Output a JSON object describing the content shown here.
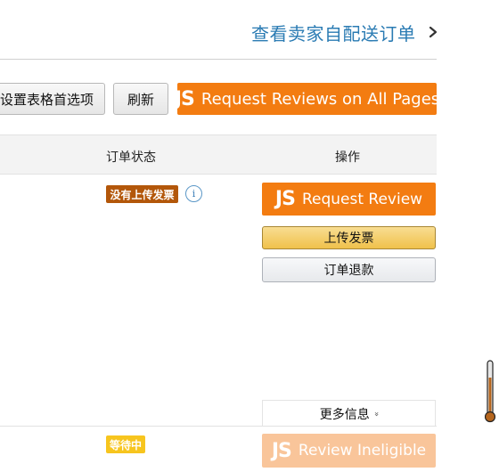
{
  "header": {
    "seller_link": "查看卖家自配送订单"
  },
  "toolbar": {
    "prefs_label": "设置表格首选项",
    "refresh_label": "刷新",
    "request_all_logo": "JS",
    "request_all_label": "Request Reviews on All Pages"
  },
  "table": {
    "columns": {
      "status": "订单状态",
      "actions": "操作"
    },
    "rows": [
      {
        "status_badge": "没有上传发票",
        "info_icon": "i",
        "review_logo": "JS",
        "review_label": "Request Review",
        "upload_label": "上传发票",
        "refund_label": "订单退款",
        "more_label": "更多信息",
        "more_chevron": "»"
      },
      {
        "status_badge": "等待中",
        "review_logo": "JS",
        "review_label": "Review Ineligible"
      }
    ]
  },
  "colors": {
    "link": "#2a7bb3",
    "accent_orange": "#f37c11",
    "disabled_orange": "#f9c59a",
    "badge_brown": "#b3570a",
    "badge_yellow": "#f7c51e",
    "upload_yellow": "#f0c14b"
  },
  "icons": {
    "chevron": "chevron-right-icon",
    "info": "info-icon",
    "scroll": "scrollbar-thumb"
  }
}
